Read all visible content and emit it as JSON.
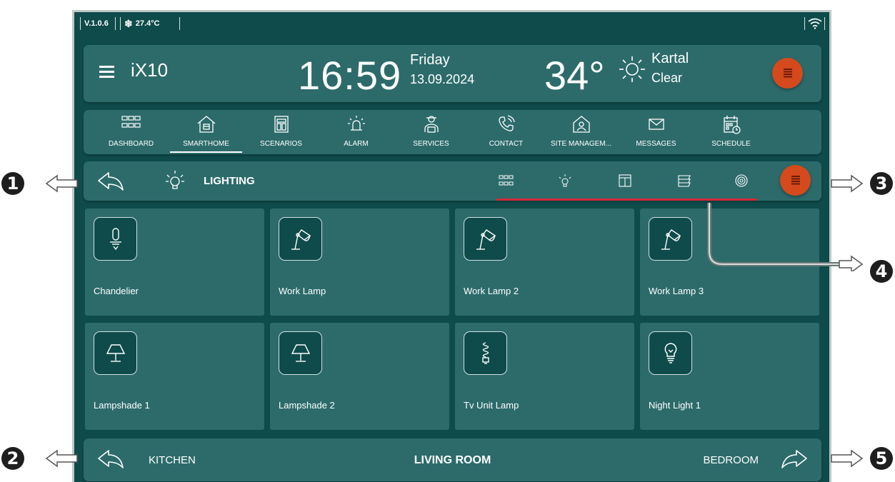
{
  "status": {
    "version": "V.1.0.6",
    "temperature": "27.4°C"
  },
  "header": {
    "title": "iX10",
    "time": "16:59",
    "day": "Friday",
    "date": "13.09.2024",
    "temp": "34°",
    "city": "Kartal",
    "condition": "Clear"
  },
  "nav": {
    "items": [
      {
        "label": "DASHBOARD",
        "icon": "grid-icon"
      },
      {
        "label": "SMARTHOME",
        "icon": "house-icon",
        "active": true
      },
      {
        "label": "SCENARIOS",
        "icon": "scenarios-icon"
      },
      {
        "label": "ALARM",
        "icon": "alarm-icon"
      },
      {
        "label": "SERVICES",
        "icon": "services-icon"
      },
      {
        "label": "CONTACT",
        "icon": "phone-icon"
      },
      {
        "label": "SITE MANAGEM...",
        "icon": "site-management-icon"
      },
      {
        "label": "MESSAGES",
        "icon": "envelope-icon"
      },
      {
        "label": "SCHEDULE",
        "icon": "calendar-icon"
      }
    ]
  },
  "subbar": {
    "title": "LIGHTING"
  },
  "tiles": [
    {
      "label": "Chandelier",
      "icon": "chandelier-icon"
    },
    {
      "label": "Work Lamp",
      "icon": "desk-lamp-icon"
    },
    {
      "label": "Work Lamp 2",
      "icon": "desk-lamp-icon"
    },
    {
      "label": "Work Lamp 3",
      "icon": "desk-lamp-icon"
    },
    {
      "label": "Lampshade 1",
      "icon": "lampshade-icon"
    },
    {
      "label": "Lampshade 2",
      "icon": "lampshade-icon"
    },
    {
      "label": "Tv Unit Lamp",
      "icon": "spiral-bulb-icon"
    },
    {
      "label": "Night Light 1",
      "icon": "bulb-icon"
    }
  ],
  "footer": {
    "prev": "KITCHEN",
    "current": "LIVING ROOM",
    "next": "BEDROOM"
  },
  "annotations": [
    "1",
    "2",
    "3",
    "4",
    "5"
  ],
  "colors": {
    "background": "#0f4b4b",
    "panel": "#2d6b6b",
    "accent": "#d44a1c",
    "underline": "#d7283a"
  }
}
